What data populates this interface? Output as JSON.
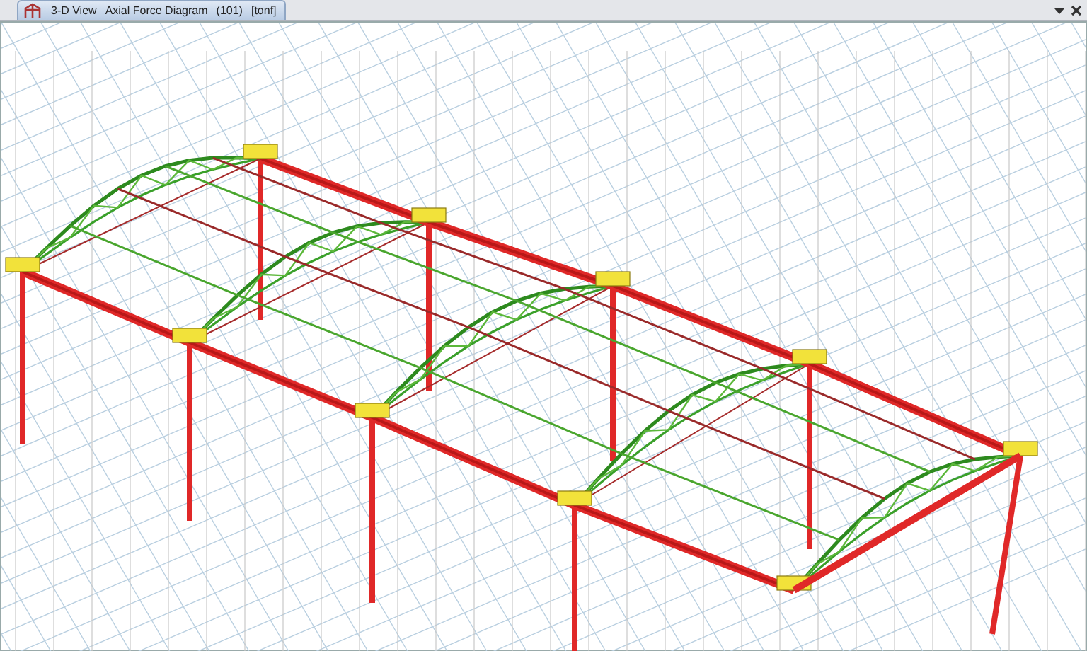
{
  "document_tab": {
    "view": "3-D View",
    "title": "Axial Force Diagram",
    "case": "(101)",
    "units": "[tonf]"
  }
}
